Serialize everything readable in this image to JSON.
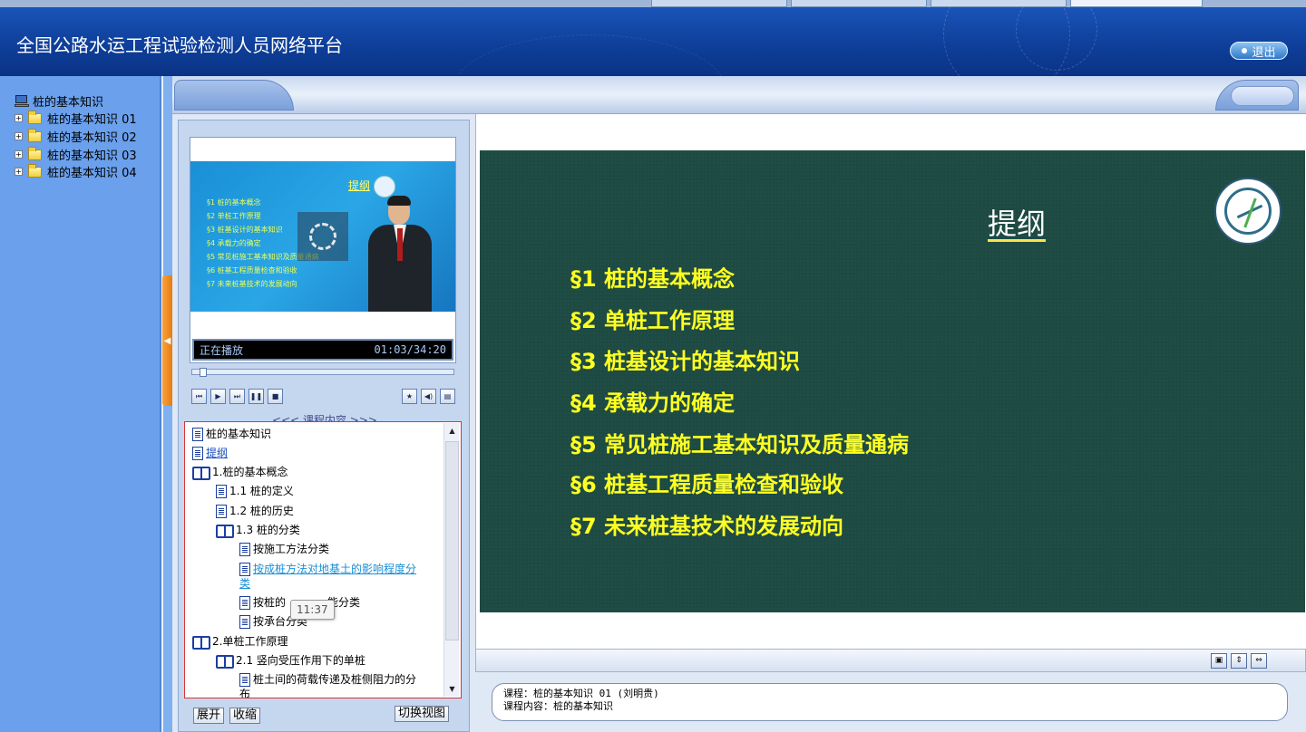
{
  "app": {
    "title": "全国公路水运工程试验检测人员网络平台",
    "logout_label": "退出"
  },
  "sidebar": {
    "root_label": "桩的基本知识",
    "items": [
      {
        "label": "桩的基本知识 01"
      },
      {
        "label": "桩的基本知识 02"
      },
      {
        "label": "桩的基本知识 03"
      },
      {
        "label": "桩的基本知识 04"
      }
    ]
  },
  "player": {
    "status_text": "正在播放",
    "time_text": "01:03/34:20",
    "progress": 0.03,
    "video": {
      "title": "提纲",
      "items": [
        "§1 桩的基本概念",
        "§2 单桩工作原理",
        "§3 桩基设计的基本知识",
        "§4 承载力的确定",
        "§5 常见桩施工基本知识及质量通病",
        "§6 桩基工程质量检查和验收",
        "§7 未来桩基技术的发展动向"
      ]
    },
    "controls": [
      "prev-icon",
      "play-icon",
      "next-icon",
      "pause-icon",
      "stop-icon",
      "star-icon",
      "volume-icon",
      "window-icon"
    ]
  },
  "course_content": {
    "label": "<<< 课程内容 >>>",
    "items": [
      {
        "text": "桩的基本知识",
        "type": "doc"
      },
      {
        "text": "提纲",
        "type": "doc-link"
      },
      {
        "text": "1.桩的基本概念",
        "type": "book"
      },
      {
        "text": "1.1 桩的定义",
        "type": "doc"
      },
      {
        "text": "1.2 桩的历史",
        "type": "doc"
      },
      {
        "text": "1.3 桩的分类",
        "type": "book"
      },
      {
        "text": "按施工方法分类",
        "type": "doc"
      },
      {
        "text": "按成桩方法对地基土的影响程度分",
        "type": "doc-link"
      },
      {
        "text": "类",
        "type": "cont-link"
      },
      {
        "text": "按桩的",
        "type": "doc"
      },
      {
        "text": "能分类",
        "type": "text"
      },
      {
        "text": "按承台分类",
        "type": "doc"
      },
      {
        "text": "2.单桩工作原理",
        "type": "book"
      },
      {
        "text": "2.1 竖向受压作用下的单桩",
        "type": "book"
      },
      {
        "text": "桩土间的荷载传递及桩侧阻力的分",
        "type": "doc"
      },
      {
        "text": "布",
        "type": "text"
      }
    ],
    "tooltip": "11:37",
    "buttons": {
      "expand": "展开",
      "collapse": "收缩",
      "switch_view": "切换视图"
    }
  },
  "slide": {
    "title": "提纲",
    "items": [
      "§1 桩的基本概念",
      "§2 单桩工作原理",
      "§3 桩基设计的基本知识",
      "§4 承载力的确定",
      "§5 常见桩施工基本知识及质量通病",
      "§6 桩基工程质量检查和验收",
      "§7 未来桩基技术的发展动向"
    ],
    "logo_icon": "pqamt-logo"
  },
  "info": {
    "course_line": "课程：桩的基本知识 01 (刘明贵)",
    "content_line": "课程内容：桩的基本知识"
  },
  "colors": {
    "header_blue": "#0e3f9a",
    "sidebar_blue": "#6aa0ec",
    "slide_bg": "#1d4a42",
    "slide_text": "#ffff22",
    "splitter_orange": "#f09030"
  }
}
